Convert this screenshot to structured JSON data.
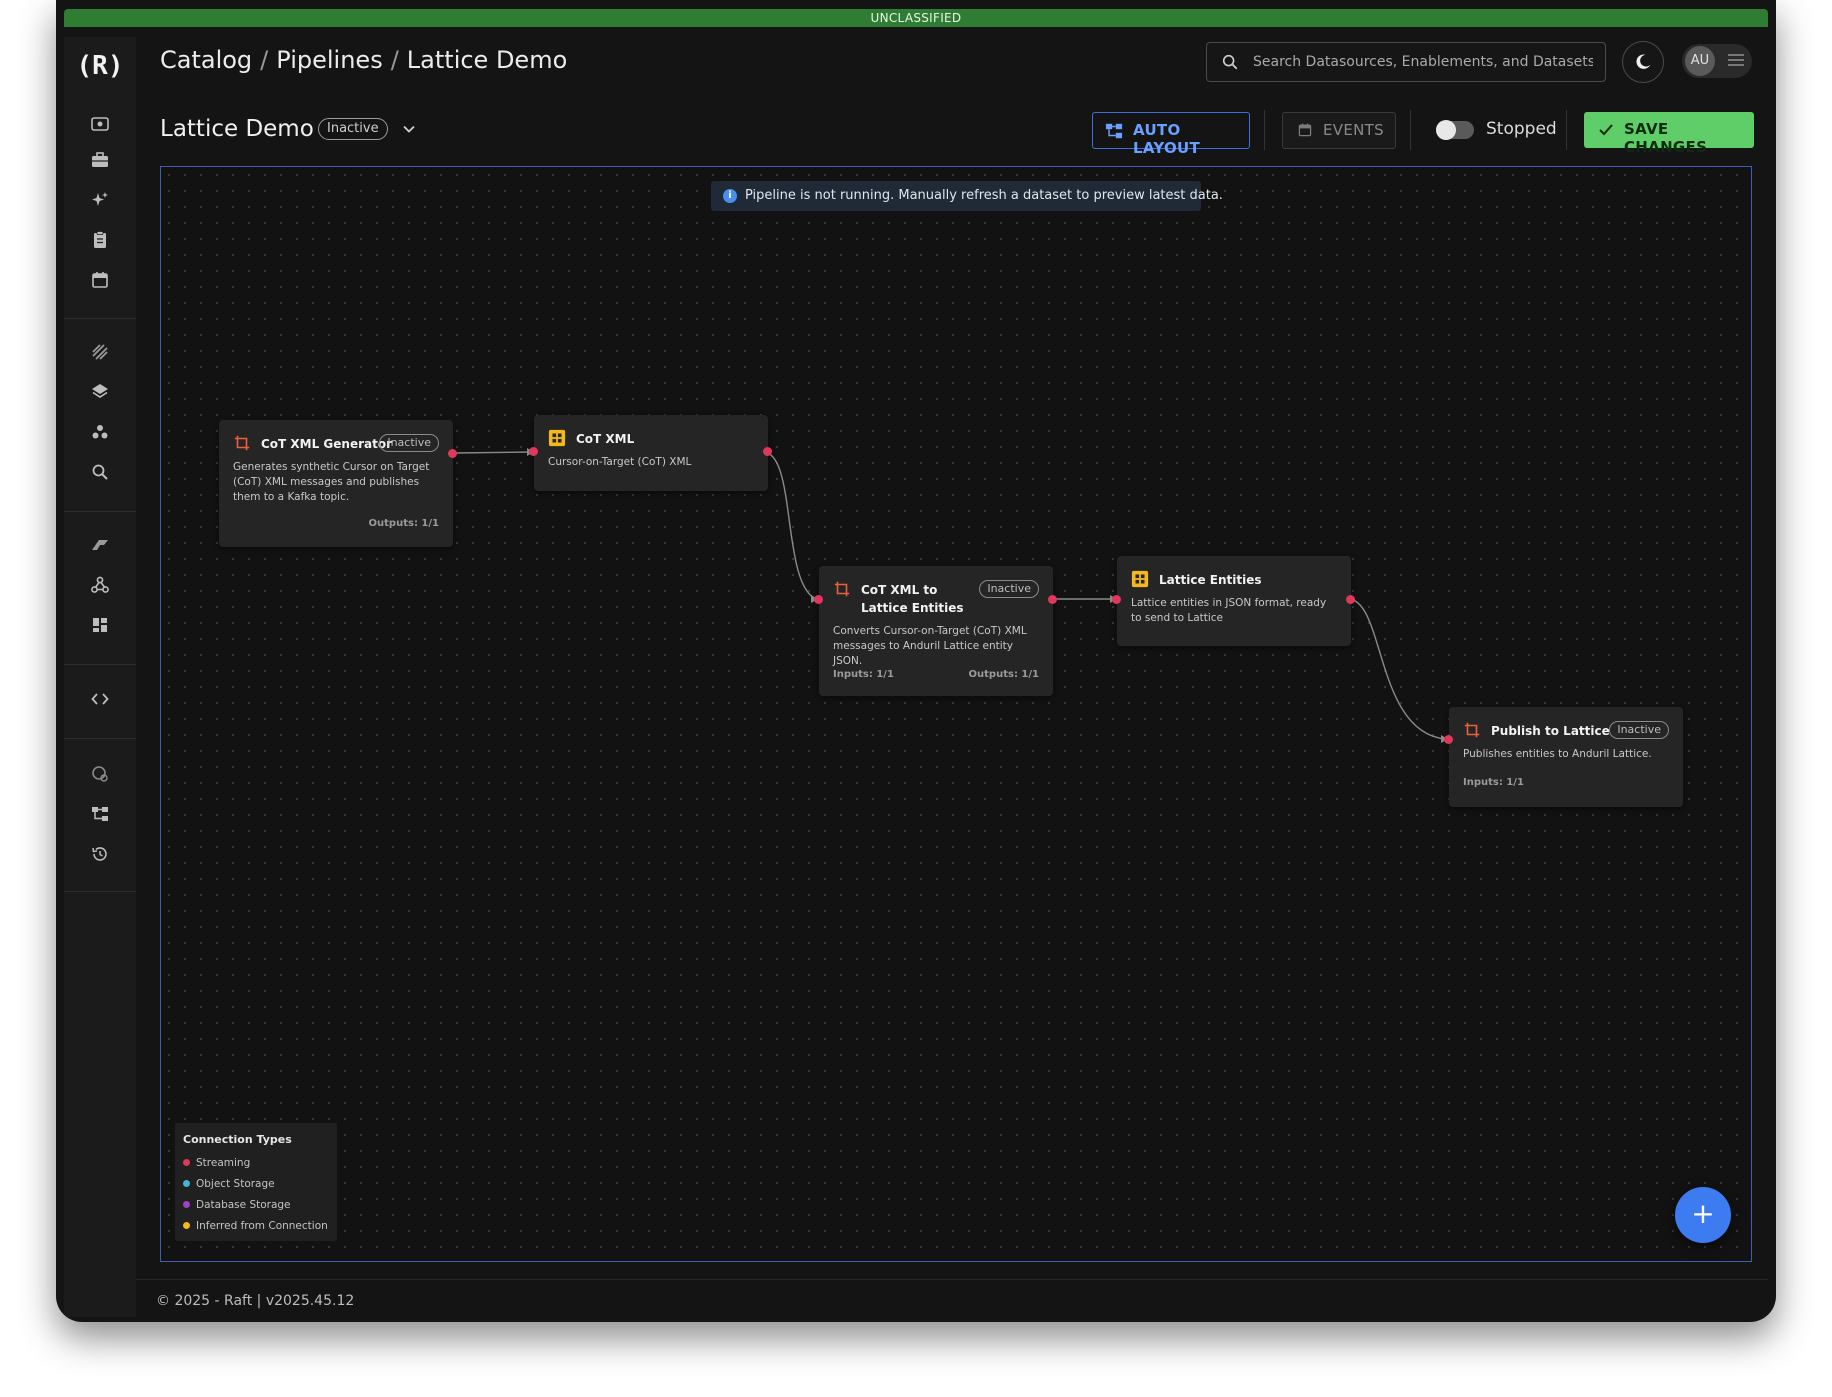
{
  "classification": "UNCLASSIFIED",
  "logo_text": "(R)",
  "breadcrumbs": [
    "Catalog",
    "Pipelines",
    "Lattice Demo"
  ],
  "breadcrumb_separator": "/",
  "search": {
    "placeholder": "Search Datasources, Enablements, and Datasets"
  },
  "user": {
    "initials": "AU"
  },
  "pipeline": {
    "title": "Lattice Demo",
    "status": "Inactive"
  },
  "toolbar": {
    "auto_layout_label": "AUTO LAYOUT",
    "events_label": "EVENTS",
    "run_state_label": "Stopped",
    "run_state_on": false,
    "save_label": "SAVE CHANGES"
  },
  "alert": {
    "icon": "i",
    "text": "Pipeline is not running. Manually refresh a dataset to preview latest data."
  },
  "sidebar_icons": [
    "eye-icon",
    "briefcase-icon",
    "sparkles-icon",
    "clipboard-icon",
    "calendar-icon",
    "layers-stripes-icon",
    "layers-icon",
    "group-icon",
    "search-icon",
    "raft-icon",
    "webhook-icon",
    "dashboard-icon",
    "code-icon",
    "shield-icon",
    "hierarchy-icon",
    "history-icon"
  ],
  "nodes": {
    "gen": {
      "title": "CoT XML Generator",
      "badge": "Inactive",
      "desc": "Generates synthetic Cursor on Target (CoT) XML messages and publishes them to a Kafka topic.",
      "outputs": "Outputs: 1/1"
    },
    "cot": {
      "title": "CoT XML",
      "desc": "Cursor-on-Target (CoT) XML"
    },
    "conv": {
      "title": "CoT XML to Lattice Entities",
      "badge": "Inactive",
      "desc": "Converts Cursor-on-Target (CoT) XML messages to Anduril Lattice entity JSON.",
      "inputs": "Inputs: 1/1",
      "outputs": "Outputs: 1/1"
    },
    "ent": {
      "title": "Lattice Entities",
      "desc": "Lattice entities in JSON format, ready to send to Lattice"
    },
    "pub": {
      "title": "Publish to Lattice",
      "badge": "Inactive",
      "desc": "Publishes entities to Anduril Lattice.",
      "inputs": "Inputs: 1/1"
    }
  },
  "legend": {
    "title": "Connection Types",
    "items": [
      {
        "label": "Streaming",
        "color": "#e0375a"
      },
      {
        "label": "Object Storage",
        "color": "#3fb6d8"
      },
      {
        "label": "Database Storage",
        "color": "#a040c8"
      },
      {
        "label": "Inferred from Connection",
        "color": "#f2b81c"
      }
    ]
  },
  "colors": {
    "accent": "#3d7cf0",
    "save": "#5fce68",
    "classification": "#2f7d32",
    "port": "#e0375a",
    "transform_icon": "#e8603c",
    "dataset_icon": "#f2b81c"
  },
  "add_button_label": "+",
  "footer": "© 2025 - Raft  | v2025.45.12"
}
